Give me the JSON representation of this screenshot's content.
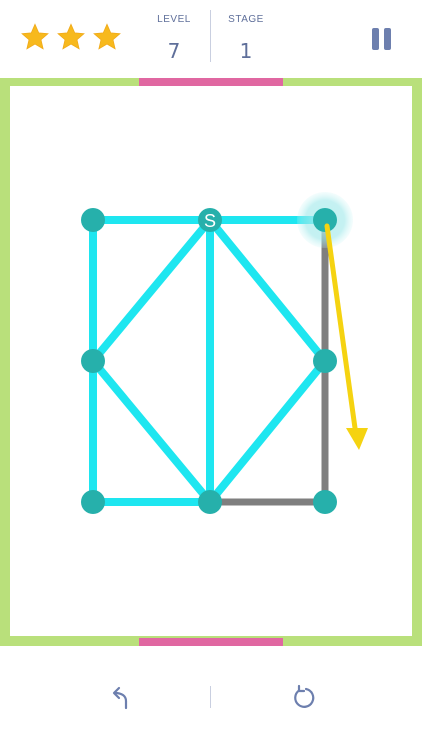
{
  "header": {
    "stars_earned": 3,
    "stars_total": 3,
    "level_label": "LEVEL",
    "level_value": "7",
    "stage_label": "STAGE",
    "stage_value": "1",
    "pause_icon": "pause-icon"
  },
  "puzzle": {
    "start_label": "S",
    "nodes": [
      {
        "id": "top-left"
      },
      {
        "id": "top-mid"
      },
      {
        "id": "top-right"
      },
      {
        "id": "mid-left"
      },
      {
        "id": "mid-right"
      },
      {
        "id": "bottom-left"
      },
      {
        "id": "bottom-mid"
      },
      {
        "id": "bottom-right"
      }
    ],
    "drawn_edges": [
      [
        "top-left",
        "top-mid"
      ],
      [
        "top-mid",
        "top-right"
      ],
      [
        "top-left",
        "mid-left"
      ],
      [
        "mid-left",
        "bottom-left"
      ],
      [
        "bottom-left",
        "bottom-mid"
      ],
      [
        "top-mid",
        "bottom-mid"
      ],
      [
        "top-mid",
        "mid-left"
      ],
      [
        "mid-left",
        "bottom-mid"
      ],
      [
        "top-mid",
        "mid-right"
      ],
      [
        "mid-right",
        "bottom-mid"
      ]
    ],
    "remaining_edges": [
      [
        "bottom-mid",
        "bottom-right"
      ],
      [
        "top-right",
        "bottom-right"
      ]
    ],
    "start_node": "top-mid",
    "current_node": "top-right",
    "hint": "top-right to bottom-right"
  },
  "colors": {
    "drawn_line": "#1ee6f0",
    "remaining_line": "#7f7f7f",
    "node": "#26b0ab",
    "hint_arrow": "#f5d311",
    "frame": "#b9e07b",
    "goal_bar": "#e067a1",
    "star": "#f7b91d",
    "text": "#5f6f9a"
  },
  "footer": {
    "undo_icon": "undo-icon",
    "restart_icon": "restart-icon"
  }
}
